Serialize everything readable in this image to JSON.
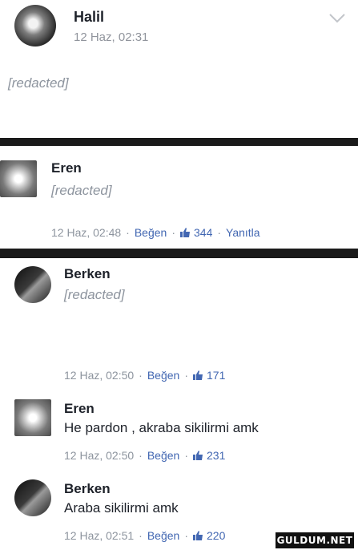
{
  "post": {
    "author": "Halil",
    "time": "12 Haz, 02:31",
    "text": "[redacted]"
  },
  "comments": [
    {
      "author": "Eren",
      "text": "[redacted]",
      "time": "12 Haz, 02:48",
      "like_label": "Beğen",
      "likes": "344",
      "reply_label": "Yanıtla"
    },
    {
      "author": "Berken",
      "text": "[redacted]",
      "time": "12 Haz, 02:50",
      "like_label": "Beğen",
      "likes": "171"
    },
    {
      "author": "Eren",
      "text": "He pardon , akraba sikilirmi amk",
      "time": "12 Haz, 02:50",
      "like_label": "Beğen",
      "likes": "231"
    },
    {
      "author": "Berken",
      "text": "Araba sikilirmi amk",
      "time": "12 Haz, 02:51",
      "like_label": "Beğen",
      "likes": "220"
    }
  ],
  "meta_separator": "·",
  "watermark": "GULDUM.NET",
  "colors": {
    "name": "#1d2129",
    "meta": "#8d949e",
    "like_accent": "#4267b2",
    "divider": "#1a1a1a"
  },
  "icons": [
    "chevron-down-icon",
    "like-thumb-icon"
  ]
}
